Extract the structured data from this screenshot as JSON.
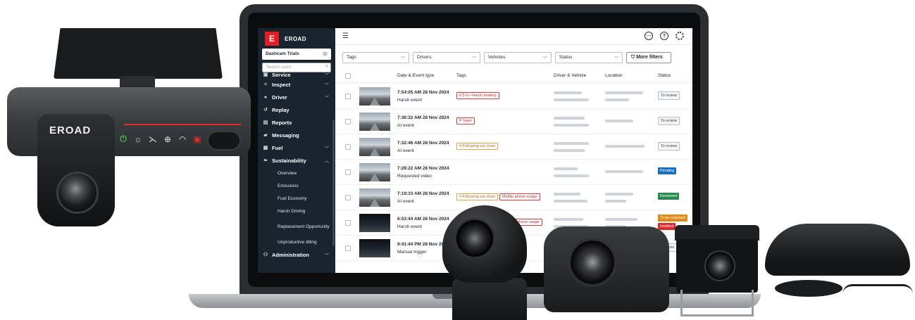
{
  "brand": {
    "logo_mark": "E",
    "name": "EROAD"
  },
  "dashcam": {
    "logo": "EROAD"
  },
  "sidebar": {
    "fleet_select": "Dashcam Trials",
    "user_search_placeholder": "Search users",
    "items": [
      {
        "label": "Service",
        "icon": "wrench-icon",
        "expandable": true
      },
      {
        "label": "Inspect",
        "icon": "clipboard-icon",
        "expandable": true
      },
      {
        "label": "Driver",
        "icon": "person-icon",
        "expandable": true
      },
      {
        "label": "Replay",
        "icon": "replay-icon",
        "expandable": false
      },
      {
        "label": "Reports",
        "icon": "document-icon",
        "expandable": false
      },
      {
        "label": "Messaging",
        "icon": "chat-icon",
        "expandable": false
      },
      {
        "label": "Fuel",
        "icon": "fuel-icon",
        "expandable": true
      },
      {
        "label": "Sustainability",
        "icon": "leaf-icon",
        "expandable": true,
        "expanded": true
      },
      {
        "label": "Administration",
        "icon": "users-icon",
        "expandable": true
      }
    ],
    "sub_items": [
      "Overview",
      "Emissions",
      "Fuel Economy",
      "Harsh Driving",
      "Replacement Opportunity",
      "Unproductive Idling"
    ]
  },
  "filters": {
    "tags": "Tags",
    "drivers": "Drivers",
    "vehicles": "Vehicles",
    "status": "Status",
    "more": "More filters"
  },
  "table": {
    "headers": {
      "date_event": "Date & Event type",
      "tags": "Tags",
      "driver_vehicle": "Driver & Vehicle",
      "location": "Location",
      "status": "Status"
    },
    "rows": [
      {
        "time": "7:54:05 AM 28 Nov 2024",
        "event": "Harsh event",
        "tags": [
          {
            "text": "0.5 G • Harsh braking",
            "color": "red"
          }
        ],
        "status": [
          "To review"
        ]
      },
      {
        "time": "7:36:32 AM 28 Nov 2024",
        "event": "AI event",
        "tags": [
          {
            "text": "¥ Yawn",
            "color": "red"
          }
        ],
        "status": [
          "To review"
        ]
      },
      {
        "time": "7:32:46 AM 28 Nov 2024",
        "event": "AI event",
        "tags": [
          {
            "text": "¥ Following too close",
            "color": "orange"
          }
        ],
        "status": [
          "To review"
        ]
      },
      {
        "time": "7:28:22 AM 28 Nov 2024",
        "event": "Requested video",
        "tags": [],
        "status": [
          "Pending"
        ]
      },
      {
        "time": "7:19:33 AM 28 Nov 2024",
        "event": "AI event",
        "tags": [
          {
            "text": "¥ Following too close",
            "color": "orange"
          },
          {
            "text": "Mobile phone usage",
            "color": "red"
          }
        ],
        "status": [
          "Reviewed"
        ]
      },
      {
        "time": "6:53:44 AM 28 Nov 2024",
        "event": "Harsh event",
        "tags": [
          {
            "text": "phone usage",
            "color": "red"
          }
        ],
        "status": [
          "To be coached",
          "Incident"
        ]
      },
      {
        "time": "9:41:44 PM 28 Nov 202",
        "event": "Manual trigger",
        "tags": [],
        "status": [
          "To revie"
        ]
      }
    ]
  },
  "colors": {
    "sidebar_bg": "#1a242f",
    "brand_red": "#e31e24",
    "pending": "#1b6fc0",
    "reviewed": "#2a8a4a",
    "coached": "#e08a18",
    "incident": "#d92b2b"
  }
}
